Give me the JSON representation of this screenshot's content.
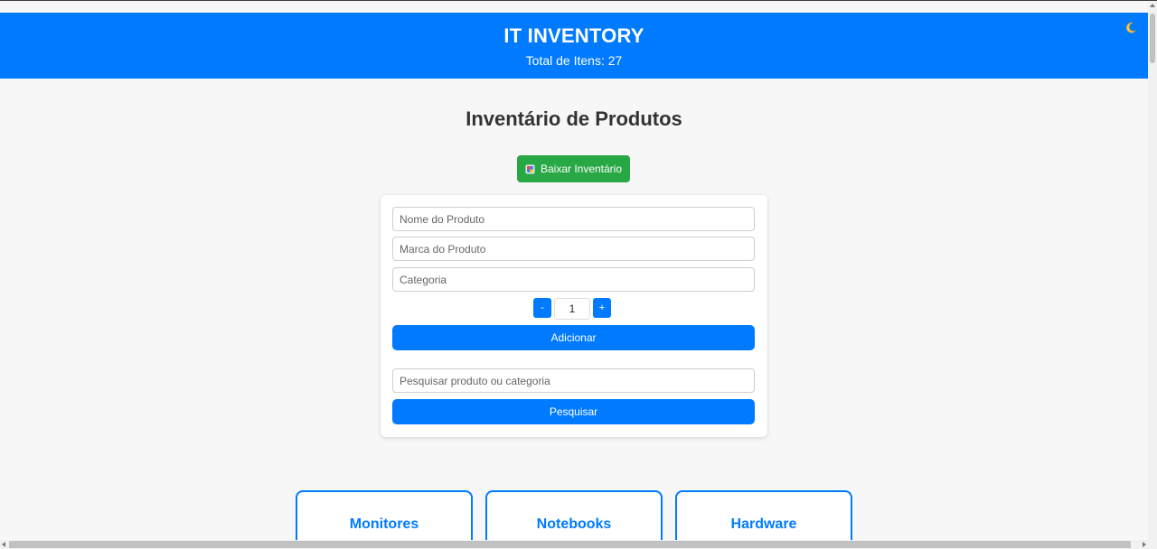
{
  "header": {
    "title": "IT INVENTORY",
    "total_text": "Total de Itens: 27",
    "theme_icon": "crescent-moon-icon"
  },
  "main": {
    "title": "Inventário de Produtos",
    "download_button": {
      "label": "Baixar Inventário",
      "icon": "package-icon"
    }
  },
  "form": {
    "product_name_placeholder": "Nome do Produto",
    "product_brand_placeholder": "Marca do Produto",
    "category_placeholder": "Categoria",
    "quantity": {
      "decrement_label": "-",
      "value": "1",
      "increment_label": "+"
    },
    "add_button_label": "Adicionar",
    "search_placeholder": "Pesquisar produto ou categoria",
    "search_button_label": "Pesquisar"
  },
  "categories": [
    {
      "label": "Monitores"
    },
    {
      "label": "Notebooks"
    },
    {
      "label": "Hardware"
    }
  ],
  "colors": {
    "primary": "#007bff",
    "success": "#28a745",
    "background": "#f7f7f7"
  }
}
